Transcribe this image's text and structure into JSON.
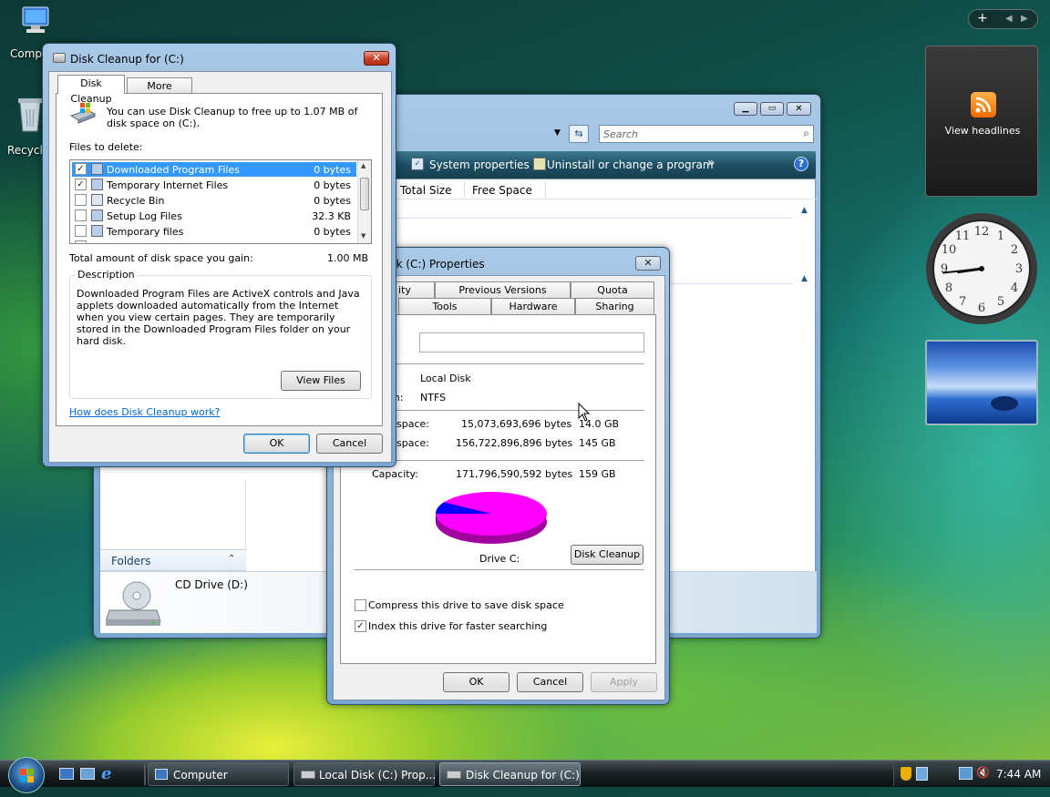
{
  "desktop": {
    "icons": [
      {
        "label": "Comp",
        "icon": "computer-icon"
      },
      {
        "label": "Recycle",
        "icon": "recycle-bin-icon"
      }
    ]
  },
  "sidebar_gadgets": {
    "feed_label": "View headlines",
    "clock": {
      "hour": 8,
      "minute": 44
    }
  },
  "explorer": {
    "search_placeholder": "Search",
    "toolbar": [
      "System properties",
      "Uninstall or change a program"
    ],
    "more": "»",
    "help": "?",
    "columns": [
      "Total Size",
      "Free Space"
    ],
    "folders_label": "Folders",
    "cd_drive_label": "CD Drive (D:)"
  },
  "properties": {
    "title": "Local Disk (C:) Properties",
    "title_visible": "isk (C:) Properties",
    "tabs_row1": [
      "ity",
      "Previous Versions",
      "Quota"
    ],
    "tabs_row2": [
      "Tools",
      "Hardware",
      "Sharing"
    ],
    "name_value": "",
    "type_label": "",
    "type_value": "Local Disk",
    "fs_label": "m:",
    "fs_value": "NTFS",
    "used_label": "space:",
    "used_bytes": "15,073,693,696 bytes",
    "used_gb": "14.0 GB",
    "free_label": "space:",
    "free_bytes": "156,722,896,896 bytes",
    "free_gb": "145 GB",
    "capacity_label": "Capacity:",
    "capacity_bytes": "171,796,590,592 bytes",
    "capacity_gb": "159 GB",
    "drive_label": "Drive C:",
    "disk_cleanup_button": "Disk Cleanup",
    "compress_label": "Compress this drive to save disk space",
    "compress_checked": false,
    "index_label": "Index this drive for faster searching",
    "index_checked": true,
    "ok": "OK",
    "cancel": "Cancel",
    "apply": "Apply",
    "pie": {
      "used_fraction": 0.088,
      "used_color": "#0000ff",
      "free_color": "#ff00ff"
    }
  },
  "cleanup": {
    "title": "Disk Cleanup for  (C:)",
    "tabs": [
      "Disk Cleanup",
      "More Options"
    ],
    "intro": "You can use Disk Cleanup to free up to 1.07 MB of disk space on  (C:).",
    "files_label": "Files to delete:",
    "files": [
      {
        "name": "Downloaded Program Files",
        "size": "0 bytes",
        "checked": true,
        "selected": true
      },
      {
        "name": "Temporary Internet Files",
        "size": "0 bytes",
        "checked": true,
        "selected": false
      },
      {
        "name": "Recycle Bin",
        "size": "0 bytes",
        "checked": false,
        "selected": false
      },
      {
        "name": "Setup Log Files",
        "size": "32.3 KB",
        "checked": false,
        "selected": false
      },
      {
        "name": "Temporary files",
        "size": "0 bytes",
        "checked": false,
        "selected": false
      }
    ],
    "total_label": "Total amount of disk space you gain:",
    "total_value": "1.00 MB",
    "description_label": "Description",
    "description": "Downloaded Program Files are ActiveX controls and Java applets downloaded automatically from the Internet when you view certain pages. They are temporarily stored in the Downloaded Program Files folder on your hard disk.",
    "view_files": "View Files",
    "help_link": "How does Disk Cleanup work?",
    "ok": "OK",
    "cancel": "Cancel"
  },
  "taskbar": {
    "buttons": [
      "Computer",
      "Local Disk (C:) Prop...",
      "Disk Cleanup for  (C:)"
    ],
    "clock": "7:44 AM"
  },
  "colors": {
    "selection": "#3399ff",
    "link": "#0066cc"
  }
}
